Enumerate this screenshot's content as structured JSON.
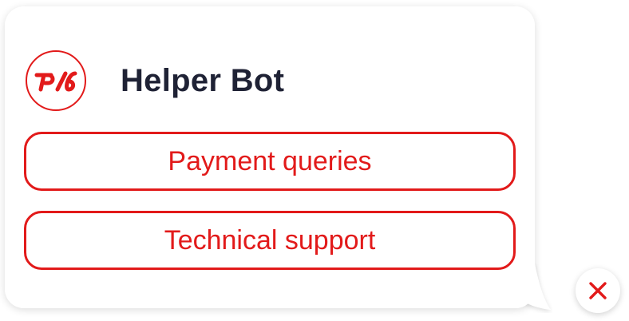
{
  "header": {
    "title": "Helper Bot",
    "logo_icon": "rzd-logo-icon"
  },
  "options": [
    {
      "label": "Payment queries"
    },
    {
      "label": "Technical support"
    }
  ],
  "close": {
    "icon": "close-icon"
  },
  "colors": {
    "accent": "#e21a1a",
    "title": "#1f2235",
    "background": "#ffffff"
  }
}
